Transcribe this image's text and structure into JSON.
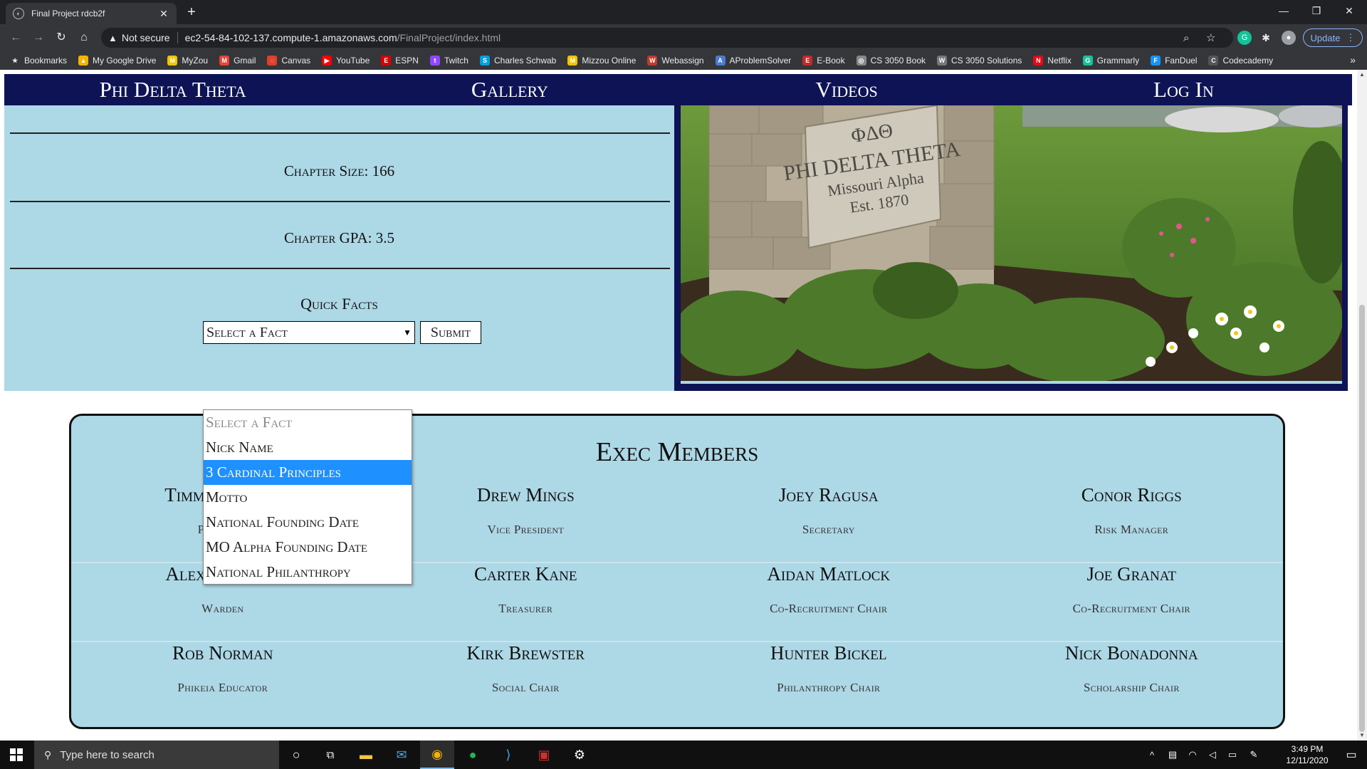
{
  "browser": {
    "tab_title": "Final Project rdcb2f",
    "new_tab": "+",
    "security_label": "Not secure",
    "url_host": "ec2-54-84-102-137.compute-1.amazonaws.com",
    "url_path": "/FinalProject/index.html",
    "update_label": "Update",
    "bookmarks": [
      {
        "label": "Bookmarks",
        "color": "#e8eaed",
        "glyph": "★"
      },
      {
        "label": "My Google Drive",
        "color": "#f4b400",
        "glyph": "▲"
      },
      {
        "label": "MyZou",
        "color": "#f1c400",
        "glyph": "M"
      },
      {
        "label": "Gmail",
        "color": "#ea4335",
        "glyph": "M"
      },
      {
        "label": "Canvas",
        "color": "#e13f2a",
        "glyph": "◌"
      },
      {
        "label": "YouTube",
        "color": "#ff0000",
        "glyph": "▶"
      },
      {
        "label": "ESPN",
        "color": "#d00",
        "glyph": "E"
      },
      {
        "label": "Twitch",
        "color": "#9146ff",
        "glyph": "t"
      },
      {
        "label": "Charles Schwab",
        "color": "#00a0df",
        "glyph": "S"
      },
      {
        "label": "Mizzou Online",
        "color": "#f1c400",
        "glyph": "M"
      },
      {
        "label": "Webassign",
        "color": "#c0392b",
        "glyph": "W"
      },
      {
        "label": "AProblemSolver",
        "color": "#4a7bd0",
        "glyph": "A"
      },
      {
        "label": "E-Book",
        "color": "#c62828",
        "glyph": "E"
      },
      {
        "label": "CS 3050 Book",
        "color": "#888",
        "glyph": "◎"
      },
      {
        "label": "CS 3050 Solutions",
        "color": "#777",
        "glyph": "W"
      },
      {
        "label": "Netflix",
        "color": "#e50914",
        "glyph": "N"
      },
      {
        "label": "Grammarly",
        "color": "#15c39a",
        "glyph": "G"
      },
      {
        "label": "FanDuel",
        "color": "#1493ff",
        "glyph": "F"
      },
      {
        "label": "Codecademy",
        "color": "#555",
        "glyph": "C"
      }
    ]
  },
  "nav": {
    "items": [
      "Phi Delta Theta",
      "Gallery",
      "Videos",
      "Log In"
    ]
  },
  "facts": {
    "chapter_size": "Chapter Size: 166",
    "chapter_gpa": "Chapter GPA: 3.5",
    "quick_facts_title": "Quick Facts",
    "select_value": "Select a Fact",
    "submit_label": "Submit",
    "options": [
      {
        "label": "Select a Fact",
        "state": "disabled"
      },
      {
        "label": "Nick Name",
        "state": "normal"
      },
      {
        "label": "3 Cardinal Principles",
        "state": "highlight"
      },
      {
        "label": "Motto",
        "state": "normal"
      },
      {
        "label": "National Founding Date",
        "state": "normal"
      },
      {
        "label": "MO Alpha Founding Date",
        "state": "normal"
      },
      {
        "label": "National Philanthropy",
        "state": "normal"
      }
    ]
  },
  "photo": {
    "sign_letters": "ΦΔΘ",
    "sign_line1": "PHI DELTA THETA",
    "sign_line2": "Missouri Alpha",
    "sign_line3": "Est. 1870"
  },
  "exec": {
    "title": "Exec Members",
    "rows": [
      [
        {
          "name": "Timmy Nguyen",
          "role": "President"
        },
        {
          "name": "Drew Mings",
          "role": "Vice President"
        },
        {
          "name": "Joey Ragusa",
          "role": "Secretary"
        },
        {
          "name": "Conor Riggs",
          "role": "Risk Manager"
        }
      ],
      [
        {
          "name": "Alex Gardner",
          "role": "Warden"
        },
        {
          "name": "Carter Kane",
          "role": "Treasurer"
        },
        {
          "name": "Aidan Matlock",
          "role": "Co-Recruitment Chair"
        },
        {
          "name": "Joe Granat",
          "role": "Co-Recruitment Chair"
        }
      ],
      [
        {
          "name": "Rob Norman",
          "role": "Phikeia Educator"
        },
        {
          "name": "Kirk Brewster",
          "role": "Social Chair"
        },
        {
          "name": "Hunter Bickel",
          "role": "Philanthropy Chair"
        },
        {
          "name": "Nick Bonadonna",
          "role": "Scholarship Chair"
        }
      ]
    ]
  },
  "taskbar": {
    "search_placeholder": "Type here to search",
    "time": "3:49 PM",
    "date": "12/11/2020"
  }
}
